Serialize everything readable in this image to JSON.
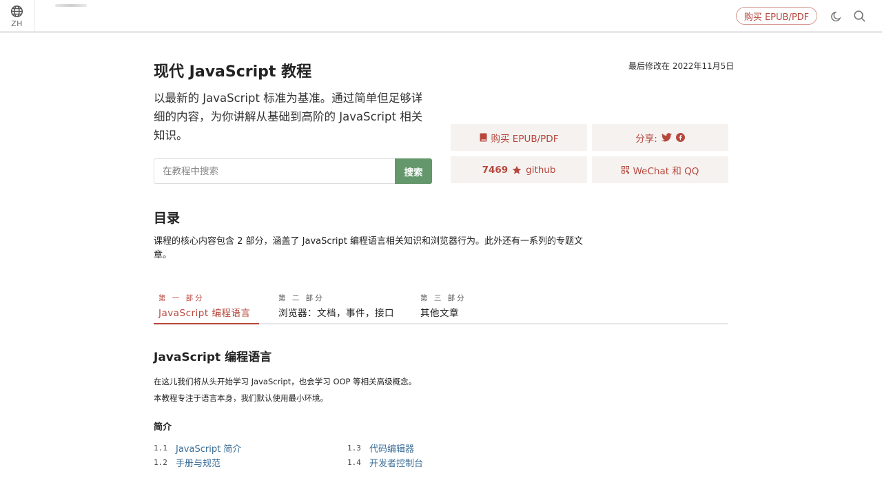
{
  "topbar": {
    "lang_code": "ZH",
    "buy_label": "购买 EPUB/PDF",
    "icons": {
      "lang": "globe-icon",
      "theme": "moon-icon",
      "search": "search-icon"
    }
  },
  "hero": {
    "title": "现代 JavaScript 教程",
    "last_modified": "最后修改在 2022年11月5日",
    "subtitle": "以最新的 JavaScript 标准为基准。通过简单但足够详细的内容，为你讲解从基础到高阶的 JavaScript 相关知识。",
    "search": {
      "placeholder": "在教程中搜索",
      "button": "搜索"
    },
    "actions": {
      "buy": "购买 EPUB/PDF",
      "share": "分享:",
      "github_count": "7469",
      "github_label": "github",
      "wechat": "WeChat 和 QQ"
    }
  },
  "toc": {
    "heading": "目录",
    "description": "课程的核心内容包含 2 部分，涵盖了 JavaScript 编程语言相关知识和浏览器行为。此外还有一系列的专题文章。",
    "tabs": [
      {
        "part": "第 一 部分",
        "name": "JavaScript 编程语言"
      },
      {
        "part": "第 二 部分",
        "name": "浏览器：文档，事件，接口"
      },
      {
        "part": "第 三 部分",
        "name": "其他文章"
      }
    ]
  },
  "section": {
    "title": "JavaScript 编程语言",
    "para1": "在这儿我们将从头开始学习 JavaScript，也会学习 OOP 等相关高级概念。",
    "para2": "本教程专注于语言本身，我们默认使用最小环境。",
    "subhead": "简介",
    "items": [
      {
        "num": "1.1",
        "label": "JavaScript 简介"
      },
      {
        "num": "1.2",
        "label": "手册与规范"
      },
      {
        "num": "1.3",
        "label": "代码编辑器"
      },
      {
        "num": "1.4",
        "label": "开发者控制台"
      }
    ]
  },
  "colors": {
    "accent": "#b7473d",
    "search_button": "#64976b",
    "link": "#3b6e98",
    "action_bg": "#f5f2f0"
  }
}
